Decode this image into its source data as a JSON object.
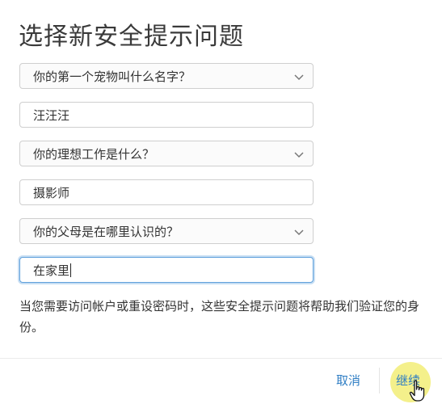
{
  "title": "选择新安全提示问题",
  "questions": [
    {
      "question": "你的第一个宠物叫什么名字？",
      "answer": "汪汪汪"
    },
    {
      "question": "你的理想工作是什么？",
      "answer": "摄影师"
    },
    {
      "question": "你的父母是在哪里认识的？",
      "answer": "在家里"
    }
  ],
  "description": "当您需要访问帐户或重设密码时，这些安全提示问题将帮助我们验证您的身份。",
  "footer": {
    "cancel_label": "取消",
    "continue_label": "继续"
  },
  "colors": {
    "accent": "#2f7ec4",
    "focus_border": "#5fa0dc",
    "highlight": "#f0eb64"
  },
  "icons": {
    "select_arrow": "chevron-down-icon",
    "cursor": "hand-pointer-icon"
  }
}
